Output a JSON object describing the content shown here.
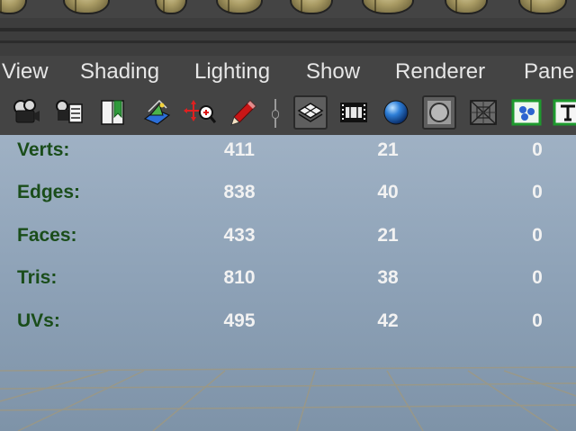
{
  "menu": {
    "items": [
      {
        "label": "View"
      },
      {
        "label": "Shading"
      },
      {
        "label": "Lighting"
      },
      {
        "label": "Show"
      },
      {
        "label": "Renderer"
      },
      {
        "label": "Pane"
      }
    ]
  },
  "toolbar": {
    "buttons": [
      {
        "icon": "camera-attributes-icon",
        "pressed": false
      },
      {
        "icon": "camera-list-icon",
        "pressed": false
      },
      {
        "icon": "bookmark-icon",
        "pressed": false
      },
      {
        "icon": "image-plane-icon",
        "pressed": false
      },
      {
        "icon": "2d-pan-zoom-icon",
        "pressed": false
      },
      {
        "icon": "grease-pencil-icon",
        "pressed": false
      },
      {
        "icon": "grid-icon",
        "pressed": true
      },
      {
        "icon": "film-gate-icon",
        "pressed": false
      },
      {
        "icon": "shaded-sphere-icon",
        "pressed": false
      },
      {
        "icon": "wireframe-on-shaded-icon",
        "pressed": true
      },
      {
        "icon": "xray-icon",
        "pressed": false
      },
      {
        "icon": "isolate-select-icon",
        "pressed": false
      },
      {
        "icon": "text-texture-icon",
        "pressed": false
      }
    ]
  },
  "hud": {
    "rows": [
      {
        "label": "Verts:",
        "values": [
          "411",
          "21",
          "0"
        ]
      },
      {
        "label": "Edges:",
        "values": [
          "838",
          "40",
          "0"
        ]
      },
      {
        "label": "Faces:",
        "values": [
          "433",
          "21",
          "0"
        ]
      },
      {
        "label": "Tris:",
        "values": [
          "810",
          "38",
          "0"
        ]
      },
      {
        "label": "UVs:",
        "values": [
          "495",
          "42",
          "0"
        ]
      }
    ]
  },
  "colors": {
    "menu_bg": "#444444",
    "hud_label": "#1a4d1a",
    "hud_value": "#f2f2f2",
    "viewport_top": "#9fb1c4",
    "viewport_bottom": "#7e93a8",
    "grid_line": "#a0987e"
  }
}
